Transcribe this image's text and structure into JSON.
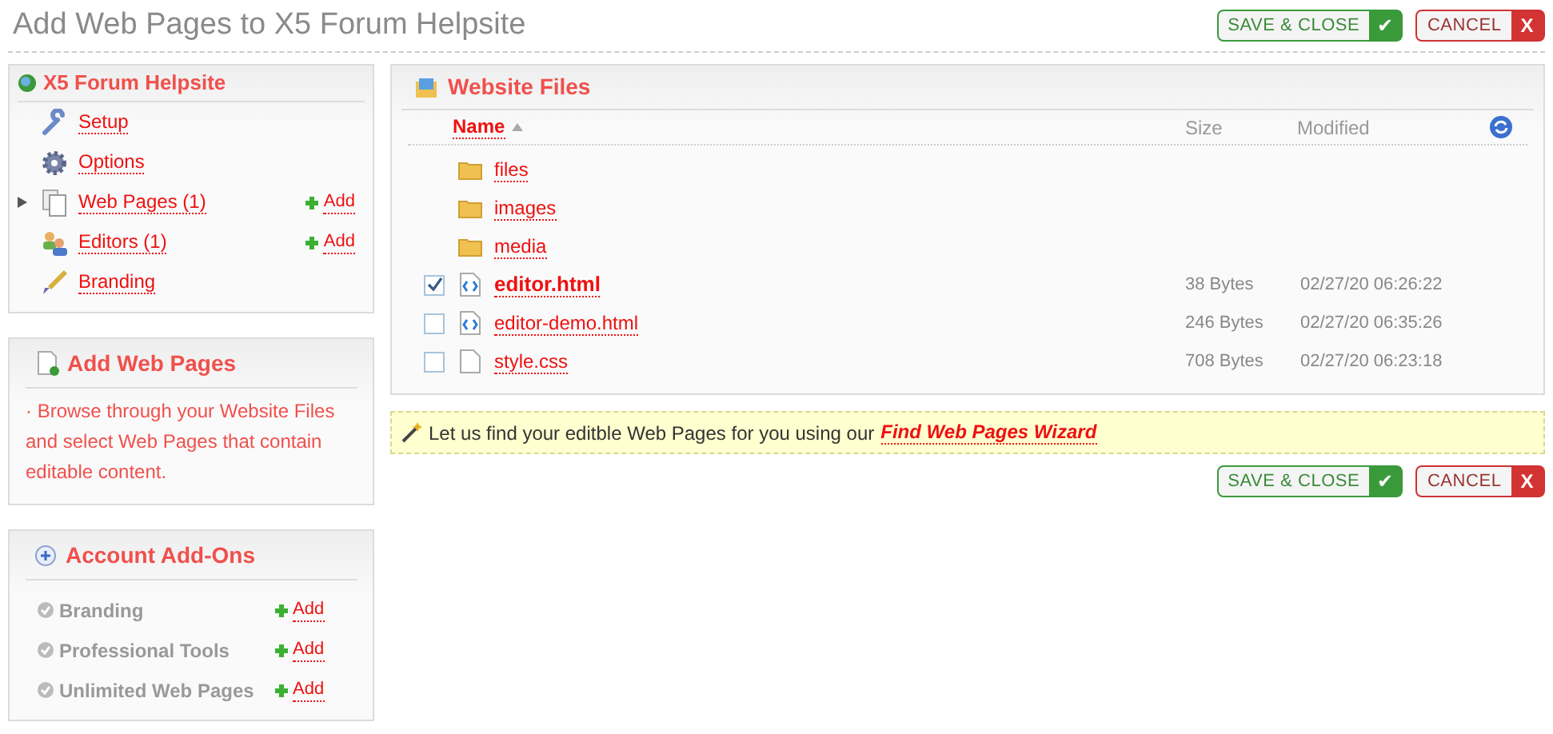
{
  "title": "Add Web Pages to X5 Forum Helpsite",
  "top_actions": {
    "save": "SAVE & CLOSE",
    "check": "✔",
    "cancel": "CANCEL",
    "x": "X"
  },
  "site_panel": {
    "title": "X5 Forum Helpsite",
    "items": [
      {
        "kind": "wrench",
        "label": "Setup"
      },
      {
        "kind": "gear",
        "label": "Options"
      },
      {
        "kind": "pages",
        "label": "Web Pages (1)",
        "expandable": true,
        "add": "Add"
      },
      {
        "kind": "people",
        "label": "Editors (1)",
        "add": "Add"
      },
      {
        "kind": "brush",
        "label": "Branding"
      }
    ]
  },
  "add_panel": {
    "title": "Add Web Pages",
    "text": "· Browse through your Website Files and select Web Pages that contain editable content."
  },
  "addons_panel": {
    "title": "Account Add-Ons",
    "items": [
      {
        "label": "Branding",
        "add": "Add"
      },
      {
        "label": "Professional Tools",
        "add": "Add"
      },
      {
        "label": "Unlimited Web Pages",
        "add": "Add"
      }
    ]
  },
  "files": {
    "title": "Website Files",
    "columns": {
      "name": "Name",
      "size": "Size",
      "modified": "Modified"
    },
    "rows": [
      {
        "kind": "folder",
        "name": "files"
      },
      {
        "kind": "folder",
        "name": "images"
      },
      {
        "kind": "folder",
        "name": "media"
      },
      {
        "kind": "html",
        "name": "editor.html",
        "size": "38 Bytes",
        "modified": "02/27/20 06:26:22",
        "checked": true
      },
      {
        "kind": "html",
        "name": "editor-demo.html",
        "size": "246 Bytes",
        "modified": "02/27/20 06:35:26",
        "checked": false
      },
      {
        "kind": "plain",
        "name": "style.css",
        "size": "708 Bytes",
        "modified": "02/27/20 06:23:18",
        "checked": false
      }
    ]
  },
  "hint": {
    "text": "Let us find your editble Web Pages for you using our",
    "link": "Find Web Pages Wizard"
  },
  "bottom_actions": {
    "save": "SAVE & CLOSE",
    "check": "✔",
    "cancel": "CANCEL",
    "x": "X"
  }
}
